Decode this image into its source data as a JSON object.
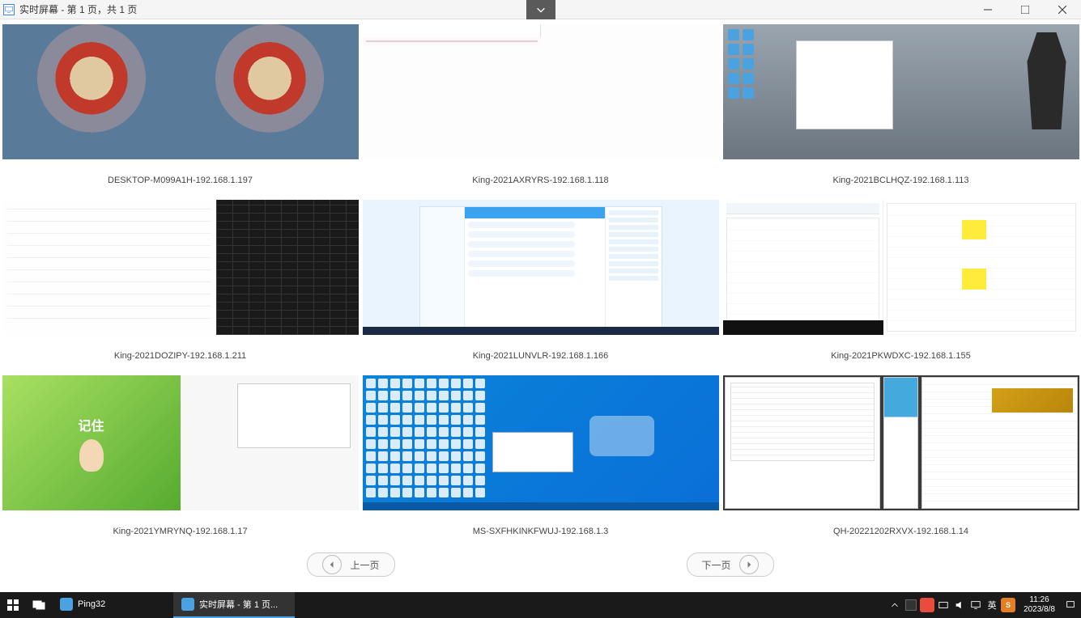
{
  "window": {
    "title": "实时屏幕 - 第 1 页，共 1 页"
  },
  "screens": [
    {
      "label": "DESKTOP-M099A1H-192.168.1.197",
      "variant": "t1"
    },
    {
      "label": "King-2021AXRYRS-192.168.1.118",
      "variant": "t2"
    },
    {
      "label": "King-2021BCLHQZ-192.168.1.113",
      "variant": "t3"
    },
    {
      "label": "King-2021DOZIPY-192.168.1.211",
      "variant": "t4"
    },
    {
      "label": "King-2021LUNVLR-192.168.1.166",
      "variant": "t5"
    },
    {
      "label": "King-2021PKWDXC-192.168.1.155",
      "variant": "t6"
    },
    {
      "label": "King-2021YMRYNQ-192.168.1.17",
      "variant": "t7"
    },
    {
      "label": "MS-SXFHKINKFWUJ-192.168.1.3",
      "variant": "t8"
    },
    {
      "label": "QH-20221202RXVX-192.168.1.14",
      "variant": "t9"
    }
  ],
  "pager": {
    "prev": "上一页",
    "next": "下一页"
  },
  "taskbar": {
    "apps": [
      {
        "label": "Ping32",
        "icon_color": "#4aa3e0"
      },
      {
        "label": "实时屏幕 - 第 1 页...",
        "icon_color": "#4aa3e0",
        "active": true
      }
    ],
    "ime": "英",
    "clock_time": "11:26",
    "clock_date": "2023/8/8"
  }
}
